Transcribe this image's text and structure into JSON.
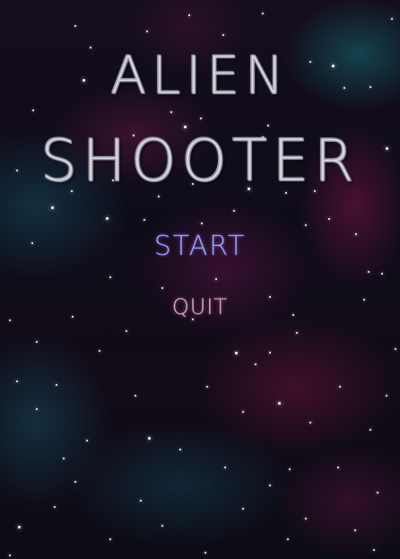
{
  "game": {
    "title_line1": "ALIEN",
    "title_line2": "SHOOTER"
  },
  "menu": {
    "start_label": "START",
    "quit_label": "QUIT"
  },
  "colors": {
    "start_text": "#b5b0f0",
    "quit_text": "#e6c0d8",
    "title_text": "#d8dbe6"
  }
}
